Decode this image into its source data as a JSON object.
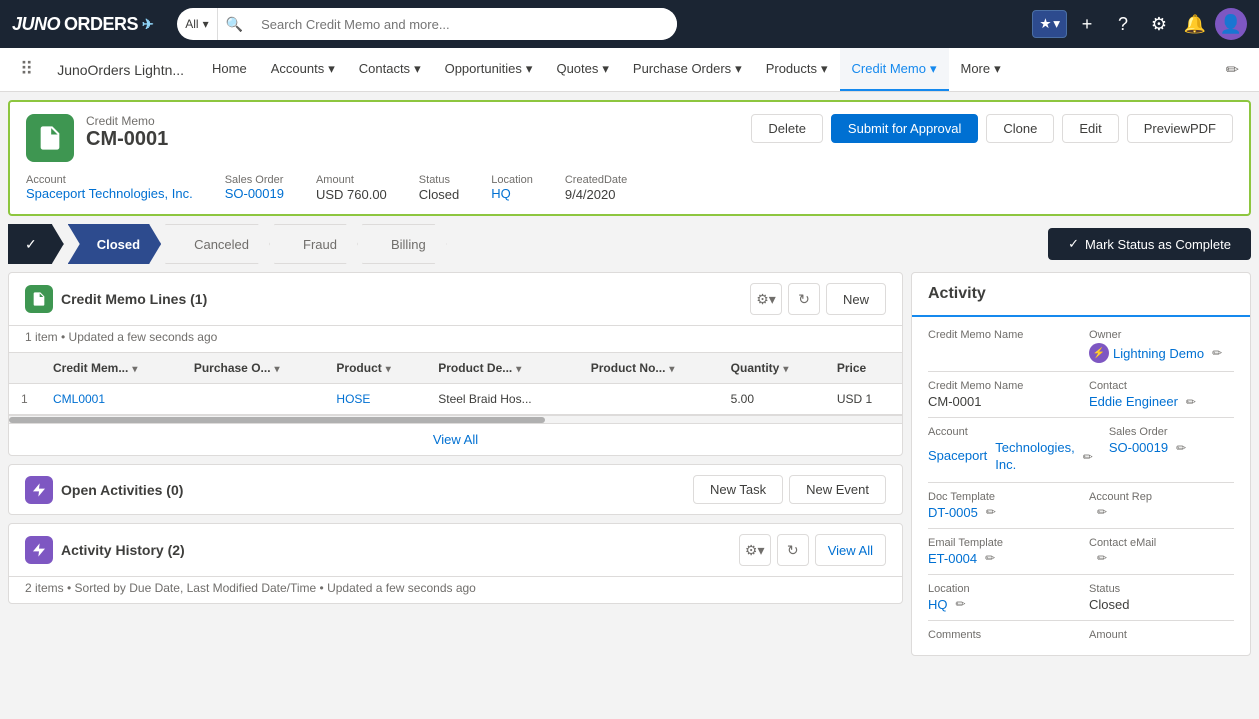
{
  "brand": {
    "name_juno": "JUNO",
    "name_orders": "ORDERS",
    "arrow": "✈"
  },
  "search": {
    "scope": "All",
    "placeholder": "Search Credit Memo and more..."
  },
  "nav": {
    "app_title": "JunoOrders Lightn...",
    "items": [
      {
        "label": "Home",
        "has_arrow": false
      },
      {
        "label": "Accounts",
        "has_arrow": true
      },
      {
        "label": "Contacts",
        "has_arrow": true
      },
      {
        "label": "Opportunities",
        "has_arrow": true
      },
      {
        "label": "Quotes",
        "has_arrow": true
      },
      {
        "label": "Purchase Orders",
        "has_arrow": true
      },
      {
        "label": "Products",
        "has_arrow": true
      },
      {
        "label": "Credit Memo",
        "has_arrow": true,
        "active": true
      },
      {
        "label": "More",
        "has_arrow": true
      }
    ]
  },
  "record": {
    "label": "Credit Memo",
    "name": "CM-0001",
    "buttons": {
      "delete": "Delete",
      "submit": "Submit for Approval",
      "clone": "Clone",
      "edit": "Edit",
      "preview": "PreviewPDF"
    },
    "meta": {
      "account_label": "Account",
      "account_value": "Spaceport Technologies, Inc.",
      "sales_order_label": "Sales Order",
      "sales_order_value": "SO-00019",
      "amount_label": "Amount",
      "amount_value": "USD 760.00",
      "status_label": "Status",
      "status_value": "Closed",
      "location_label": "Location",
      "location_value": "HQ",
      "created_label": "CreatedDate",
      "created_value": "9/4/2020"
    }
  },
  "status_bar": {
    "steps": [
      {
        "label": "",
        "state": "done",
        "checkmark": "✓"
      },
      {
        "label": "Closed",
        "state": "active"
      },
      {
        "label": "Canceled",
        "state": "inactive"
      },
      {
        "label": "Fraud",
        "state": "inactive"
      },
      {
        "label": "Billing",
        "state": "inactive"
      }
    ],
    "complete_btn": "Mark Status as Complete"
  },
  "credit_memo_lines": {
    "title": "Credit Memo Lines (1)",
    "subtitle": "1 item • Updated a few seconds ago",
    "new_btn": "New",
    "view_all": "View All",
    "columns": [
      "Credit Mem...",
      "Purchase O...",
      "Product",
      "Product De...",
      "Product No...",
      "Quantity",
      "Price"
    ],
    "rows": [
      {
        "num": "1",
        "credit_mem": "CML0001",
        "purchase_o": "",
        "product": "HOSE",
        "product_de": "Steel Braid Hos...",
        "product_no": "",
        "quantity": "5.00",
        "price": "USD 1"
      }
    ]
  },
  "open_activities": {
    "title": "Open Activities (0)",
    "new_task_btn": "New Task",
    "new_event_btn": "New Event"
  },
  "activity_history": {
    "title": "Activity History (2)",
    "subtitle": "2 items • Sorted by Due Date, Last Modified Date/Time • Updated a few seconds ago",
    "view_all_btn": "View All"
  },
  "activity_panel": {
    "title": "Activity",
    "fields": {
      "credit_memo_name_label": "Credit Memo Name",
      "owner_label": "Owner",
      "owner_value": "Lightning Demo",
      "credit_memo_name_value": "CM-0001",
      "contact_label": "Contact",
      "contact_value": "Eddie Engineer",
      "account_label": "Account",
      "account_value_line1": "Spaceport",
      "account_value_line2": "Technologies, Inc.",
      "sales_order_label": "Sales Order",
      "sales_order_value": "SO-00019",
      "doc_template_label": "Doc Template",
      "doc_template_value": "DT-0005",
      "account_rep_label": "Account Rep",
      "email_template_label": "Email Template",
      "email_template_value": "ET-0004",
      "contact_email_label": "Contact eMail",
      "location_label": "Location",
      "location_value": "HQ",
      "status_label": "Status",
      "status_value": "Closed",
      "comments_label": "Comments",
      "amount_label": "Amount"
    }
  }
}
